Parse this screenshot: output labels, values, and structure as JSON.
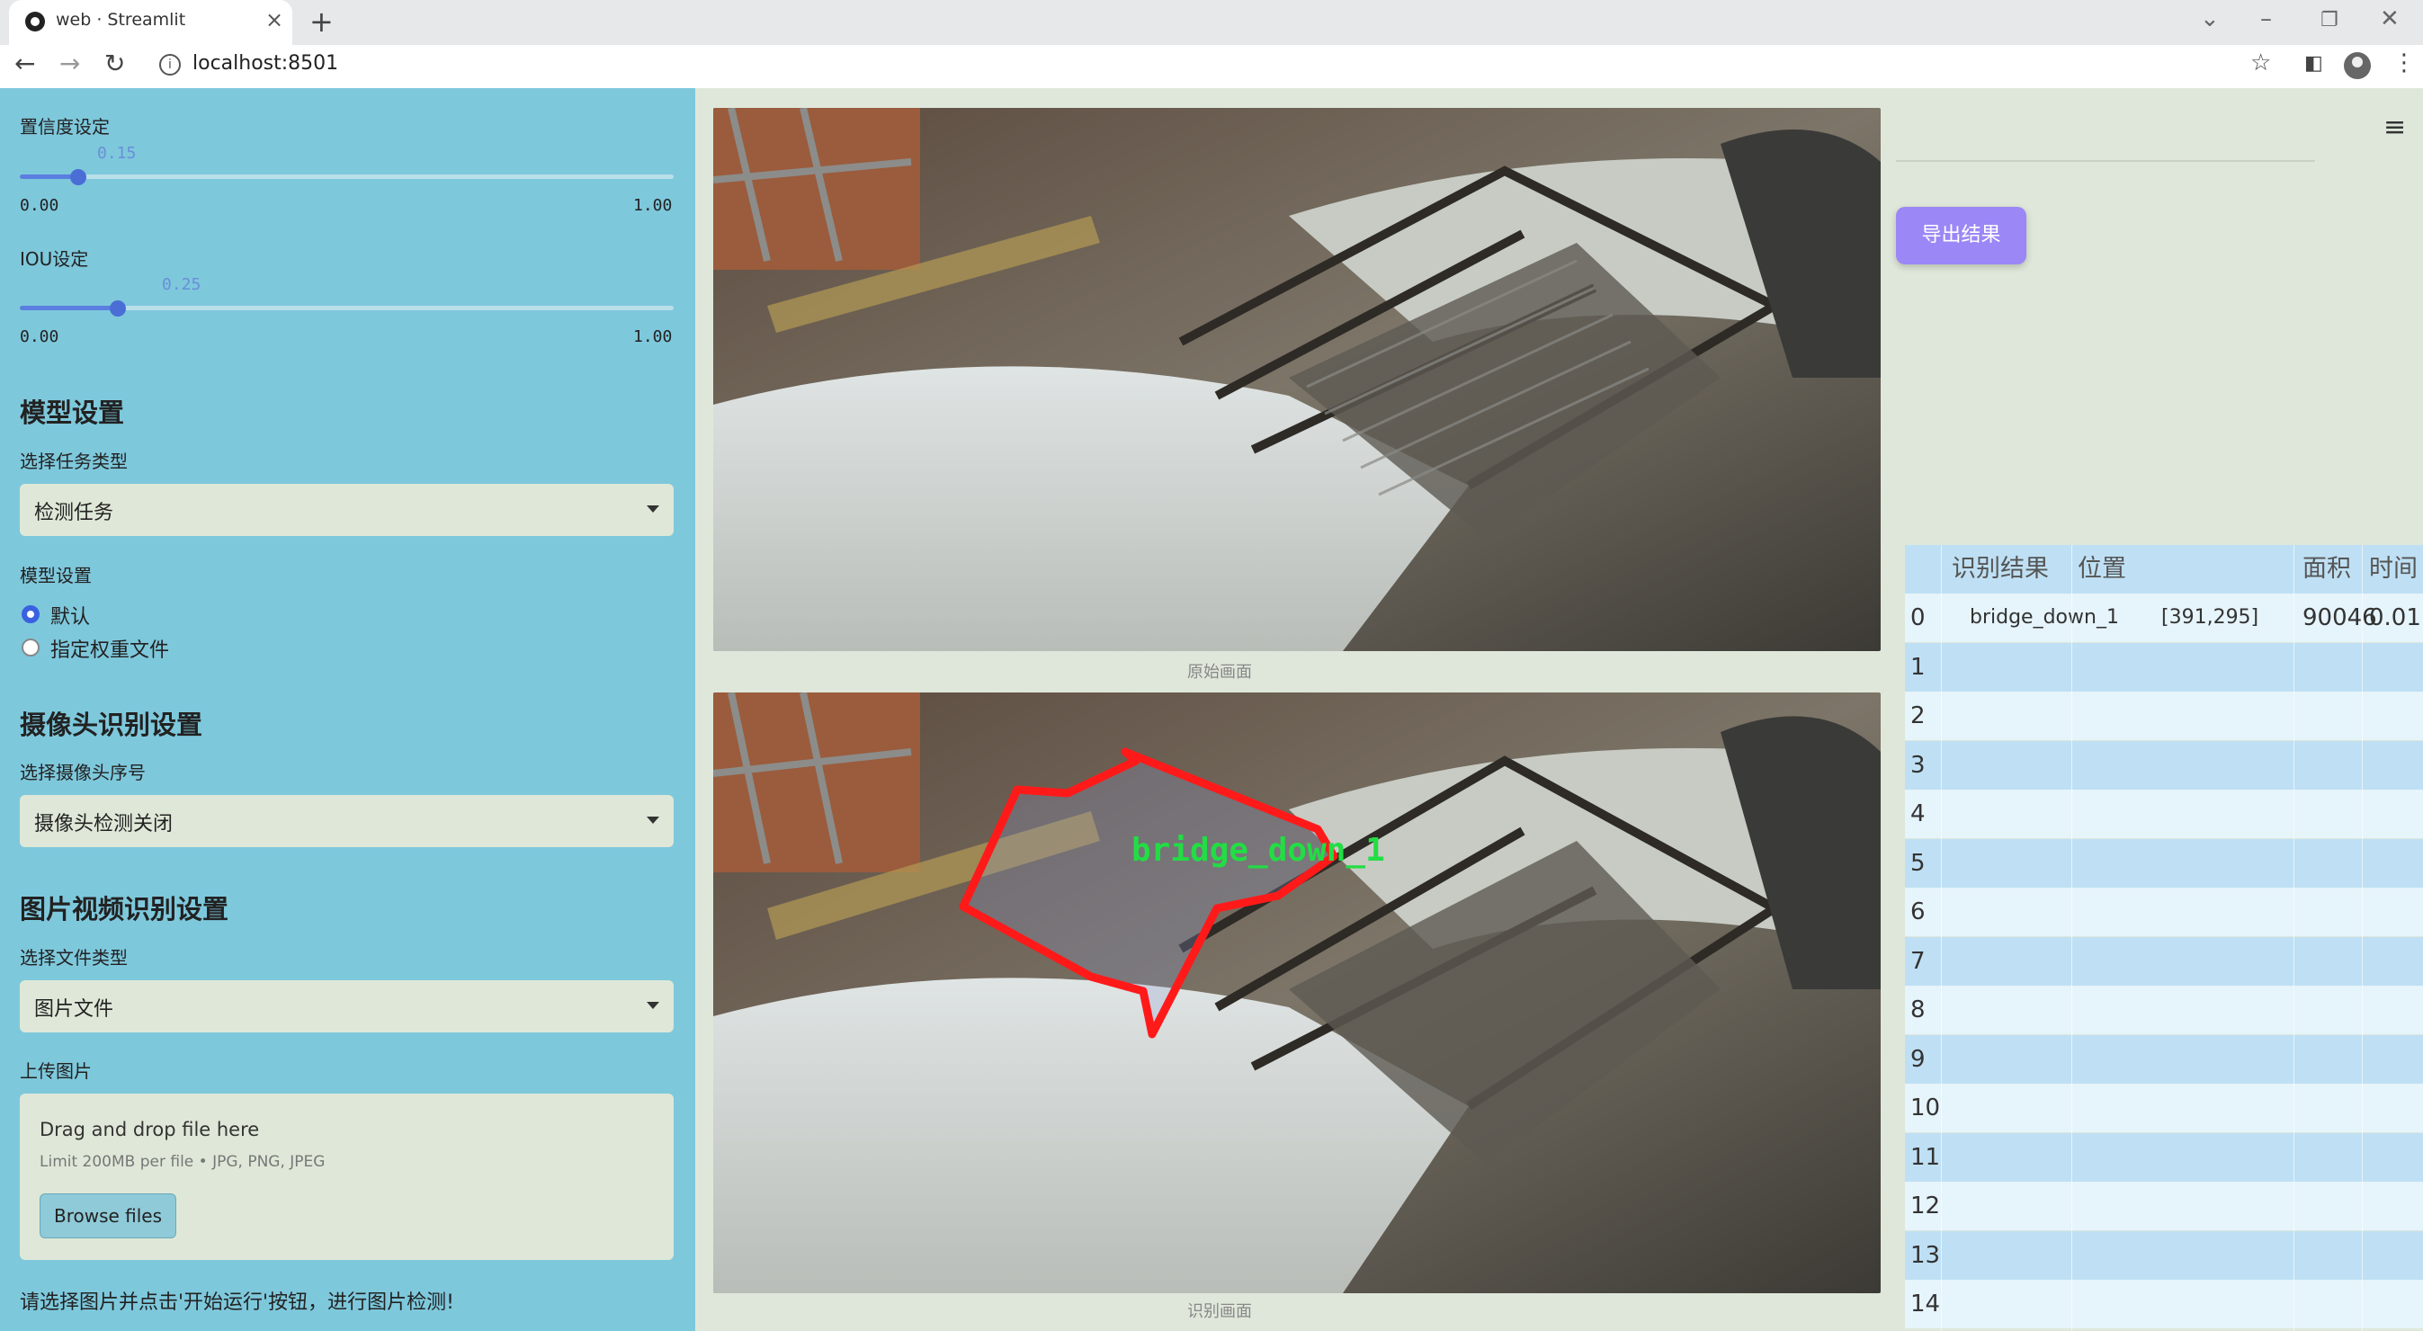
{
  "browser": {
    "tab_title": "web · Streamlit",
    "url": "localhost:8501"
  },
  "sidebar": {
    "confidence": {
      "label": "置信度设定",
      "value": "0.15",
      "min": "0.00",
      "max": "1.00",
      "fraction": 0.15
    },
    "iou": {
      "label": "IOU设定",
      "value": "0.25",
      "min": "0.00",
      "max": "1.00",
      "fraction": 0.25
    },
    "model_section": {
      "heading": "模型设置",
      "task_label": "选择任务类型",
      "task_value": "检测任务",
      "model_label": "模型设置",
      "radio_default": "默认",
      "radio_custom": "指定权重文件"
    },
    "camera_section": {
      "heading": "摄像头识别设置",
      "camera_label": "选择摄像头序号",
      "camera_value": "摄像头检测关闭"
    },
    "media_section": {
      "heading": "图片视频识别设置",
      "filetype_label": "选择文件类型",
      "filetype_value": "图片文件",
      "upload_label": "上传图片",
      "drop_text": "Drag and drop file here",
      "limit_text": "Limit 200MB per file • JPG, PNG, JPEG",
      "browse_label": "Browse files"
    },
    "hint": "请选择图片并点击'开始运行'按钮，进行图片检测!"
  },
  "main": {
    "original_caption": "原始画面",
    "result_caption": "识别画面",
    "detection_label": "bridge_down_1",
    "export_label": "导出结果"
  },
  "table": {
    "headers": [
      "",
      "识别结果",
      "位置",
      "面积",
      "时间"
    ],
    "rows": [
      [
        "0",
        "bridge_down_1",
        "[391,295]",
        "90046",
        "0.01"
      ],
      [
        "1",
        "",
        "",
        "",
        ""
      ],
      [
        "2",
        "",
        "",
        "",
        ""
      ],
      [
        "3",
        "",
        "",
        "",
        ""
      ],
      [
        "4",
        "",
        "",
        "",
        ""
      ],
      [
        "5",
        "",
        "",
        "",
        ""
      ],
      [
        "6",
        "",
        "",
        "",
        ""
      ],
      [
        "7",
        "",
        "",
        "",
        ""
      ],
      [
        "8",
        "",
        "",
        "",
        ""
      ],
      [
        "9",
        "",
        "",
        "",
        ""
      ],
      [
        "10",
        "",
        "",
        "",
        ""
      ],
      [
        "11",
        "",
        "",
        "",
        ""
      ],
      [
        "12",
        "",
        "",
        "",
        ""
      ],
      [
        "13",
        "",
        "",
        "",
        ""
      ],
      [
        "14",
        "",
        "",
        "",
        ""
      ]
    ]
  },
  "colors": {
    "sidebar_bg": "#7ec8dc",
    "main_bg": "#dfe7da",
    "accent": "#4a6ed6",
    "export_button": "#9b87f5",
    "detection_box": "#ff1a1a",
    "detection_text": "#22dd44"
  }
}
